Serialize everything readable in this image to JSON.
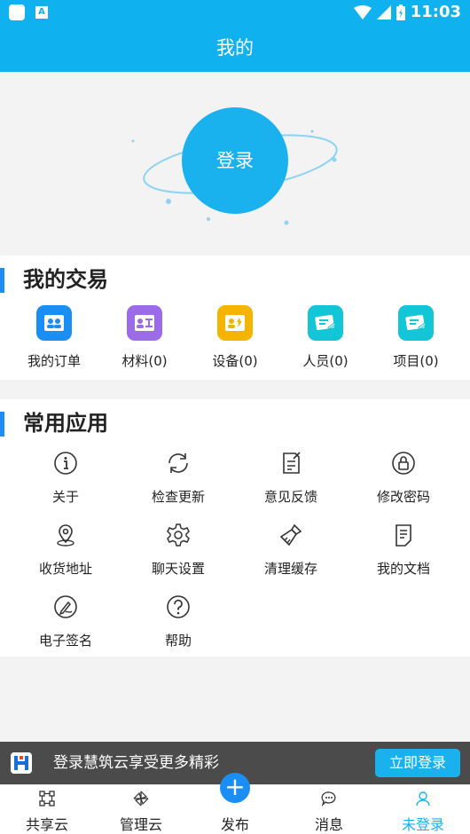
{
  "status_bar": {
    "time": "11:03",
    "badge": "A"
  },
  "header": {
    "title": "我的"
  },
  "profile": {
    "login_label": "登录"
  },
  "trade": {
    "title": "我的交易",
    "items": [
      {
        "label": "我的订单",
        "icon": "order-icon",
        "color": "#1a8ef2"
      },
      {
        "label": "材料(0)",
        "icon": "material-icon",
        "color": "#9c6be8"
      },
      {
        "label": "设备(0)",
        "icon": "equipment-icon",
        "color": "#f5b400"
      },
      {
        "label": "人员(0)",
        "icon": "personnel-icon",
        "color": "#12c6d8"
      },
      {
        "label": "项目(0)",
        "icon": "project-icon",
        "color": "#12c6d8"
      }
    ]
  },
  "apps": {
    "title": "常用应用",
    "items": [
      {
        "label": "关于",
        "icon": "info-icon"
      },
      {
        "label": "检查更新",
        "icon": "refresh-icon"
      },
      {
        "label": "意见反馈",
        "icon": "feedback-icon"
      },
      {
        "label": "修改密码",
        "icon": "lock-icon"
      },
      {
        "label": "收货地址",
        "icon": "location-icon"
      },
      {
        "label": "聊天设置",
        "icon": "gear-icon"
      },
      {
        "label": "清理缓存",
        "icon": "broom-icon"
      },
      {
        "label": "我的文档",
        "icon": "document-icon"
      },
      {
        "label": "电子签名",
        "icon": "signature-icon"
      },
      {
        "label": "帮助",
        "icon": "help-icon"
      }
    ]
  },
  "banner": {
    "text": "登录慧筑云享受更多精彩",
    "button": "立即登录"
  },
  "nav": {
    "items": [
      {
        "label": "共享云",
        "icon": "share-cloud-icon"
      },
      {
        "label": "管理云",
        "icon": "manage-cloud-icon"
      },
      {
        "label": "发布",
        "icon": "plus-icon"
      },
      {
        "label": "消息",
        "icon": "message-icon"
      },
      {
        "label": "未登录",
        "icon": "user-icon"
      }
    ],
    "active_color": "#1ab1ef"
  }
}
